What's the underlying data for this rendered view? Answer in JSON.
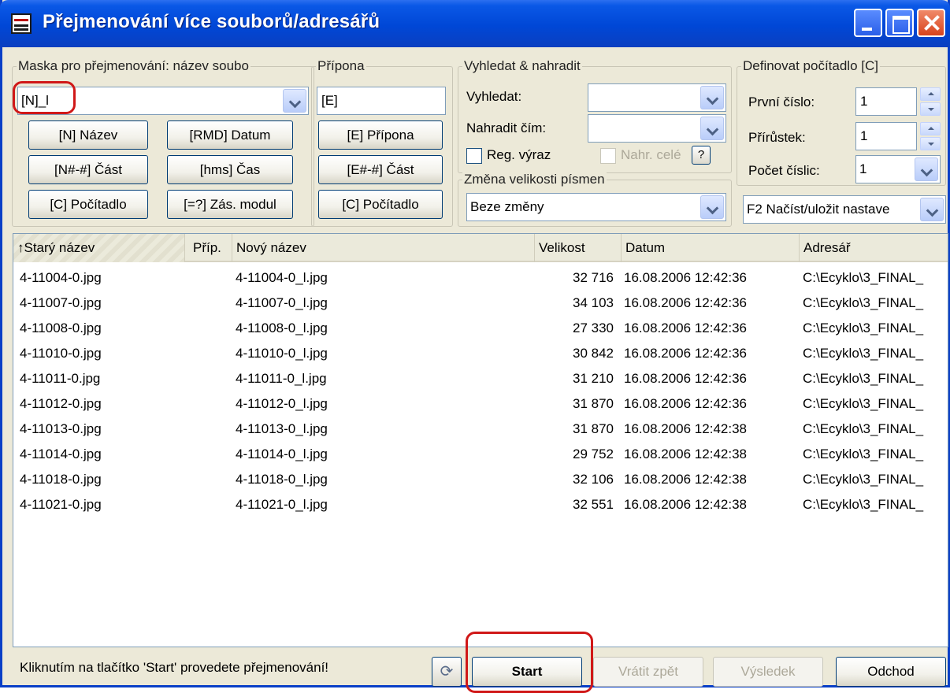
{
  "window": {
    "title": "Přejmenování více souborů/adresářů"
  },
  "mask": {
    "legend": "Maska pro přejmenování: název soubo",
    "value": "[N]_l",
    "buttons": [
      "[N] Název",
      "[RMD] Datum",
      "[N#-#] Část",
      "[hms] Čas",
      "[C] Počítadlo",
      "[=?] Zás. modul"
    ]
  },
  "extension": {
    "legend": "Přípona",
    "value": "[E]",
    "buttons": [
      "[E] Přípona",
      "[E#-#] Část",
      "[C] Počítadlo"
    ]
  },
  "search": {
    "legend": "Vyhledat & nahradit",
    "find_label": "Vyhledat:",
    "find_value": "",
    "replace_label": "Nahradit čím:",
    "replace_value": "",
    "regex_label": "Reg. výraz",
    "replace_all_label": "Nahr. celé",
    "help_label": "?"
  },
  "case": {
    "legend": "Změna velikosti písmen",
    "value": "Beze změny"
  },
  "counter": {
    "legend": "Definovat počítadlo [C]",
    "first_label": "První číslo:",
    "first_value": "1",
    "step_label": "Přírůstek:",
    "step_value": "1",
    "digits_label": "Počet číslic:",
    "digits_value": "1"
  },
  "settings_combo": {
    "value": "F2 Načíst/uložit nastave"
  },
  "table": {
    "columns": [
      "↑Starý název",
      "Příp.",
      "Nový název",
      "Velikost",
      "Datum",
      "Adresář"
    ],
    "rows": [
      {
        "old": "4-11004-0.jpg",
        "new": "4-11004-0_l.jpg",
        "size": "32 716",
        "date": "16.08.2006 12:42:36",
        "dir": "C:\\Ecyklo\\3_FINAL_"
      },
      {
        "old": "4-11007-0.jpg",
        "new": "4-11007-0_l.jpg",
        "size": "34 103",
        "date": "16.08.2006 12:42:36",
        "dir": "C:\\Ecyklo\\3_FINAL_"
      },
      {
        "old": "4-11008-0.jpg",
        "new": "4-11008-0_l.jpg",
        "size": "27 330",
        "date": "16.08.2006 12:42:36",
        "dir": "C:\\Ecyklo\\3_FINAL_"
      },
      {
        "old": "4-11010-0.jpg",
        "new": "4-11010-0_l.jpg",
        "size": "30 842",
        "date": "16.08.2006 12:42:36",
        "dir": "C:\\Ecyklo\\3_FINAL_"
      },
      {
        "old": "4-11011-0.jpg",
        "new": "4-11011-0_l.jpg",
        "size": "31 210",
        "date": "16.08.2006 12:42:36",
        "dir": "C:\\Ecyklo\\3_FINAL_"
      },
      {
        "old": "4-11012-0.jpg",
        "new": "4-11012-0_l.jpg",
        "size": "31 870",
        "date": "16.08.2006 12:42:36",
        "dir": "C:\\Ecyklo\\3_FINAL_"
      },
      {
        "old": "4-11013-0.jpg",
        "new": "4-11013-0_l.jpg",
        "size": "31 870",
        "date": "16.08.2006 12:42:38",
        "dir": "C:\\Ecyklo\\3_FINAL_"
      },
      {
        "old": "4-11014-0.jpg",
        "new": "4-11014-0_l.jpg",
        "size": "29 752",
        "date": "16.08.2006 12:42:38",
        "dir": "C:\\Ecyklo\\3_FINAL_"
      },
      {
        "old": "4-11018-0.jpg",
        "new": "4-11018-0_l.jpg",
        "size": "32 106",
        "date": "16.08.2006 12:42:38",
        "dir": "C:\\Ecyklo\\3_FINAL_"
      },
      {
        "old": "4-11021-0.jpg",
        "new": "4-11021-0_l.jpg",
        "size": "32 551",
        "date": "16.08.2006 12:42:38",
        "dir": "C:\\Ecyklo\\3_FINAL_"
      }
    ]
  },
  "status": {
    "text": "Kliknutím na tlačítko 'Start' provedete přejmenování!"
  },
  "buttons": {
    "start": "Start",
    "undo": "Vrátit zpět",
    "result": "Výsledek",
    "exit": "Odchod"
  },
  "colors": {
    "title_bar": "#0a58e6",
    "highlight": "#d01818",
    "face": "#ece9d8"
  }
}
